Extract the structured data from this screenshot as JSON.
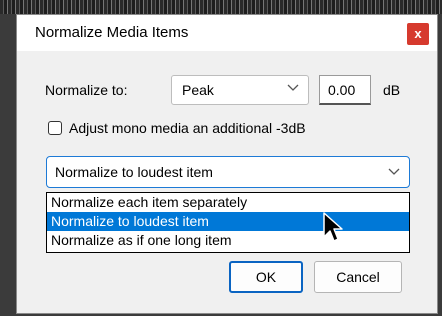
{
  "dialog": {
    "title": "Normalize Media Items",
    "close_glyph": "x"
  },
  "normalize_to": {
    "label": "Normalize to:",
    "mode_value": "Peak",
    "level_value": "0.00",
    "unit": "dB"
  },
  "mono": {
    "label": "Adjust mono media an additional -3dB",
    "checked": false
  },
  "scope": {
    "selected": "Normalize to loudest item",
    "options": [
      "Normalize each item separately",
      "Normalize to loudest item",
      "Normalize as if one long item"
    ],
    "highlighted_index": 1
  },
  "buttons": {
    "ok": "OK",
    "cancel": "Cancel"
  },
  "colors": {
    "accent": "#0078d7",
    "close": "#d63a2e"
  },
  "icons": {
    "close": "close-icon",
    "chevron": "chevron-down-icon",
    "cursor": "mouse-pointer-icon"
  }
}
